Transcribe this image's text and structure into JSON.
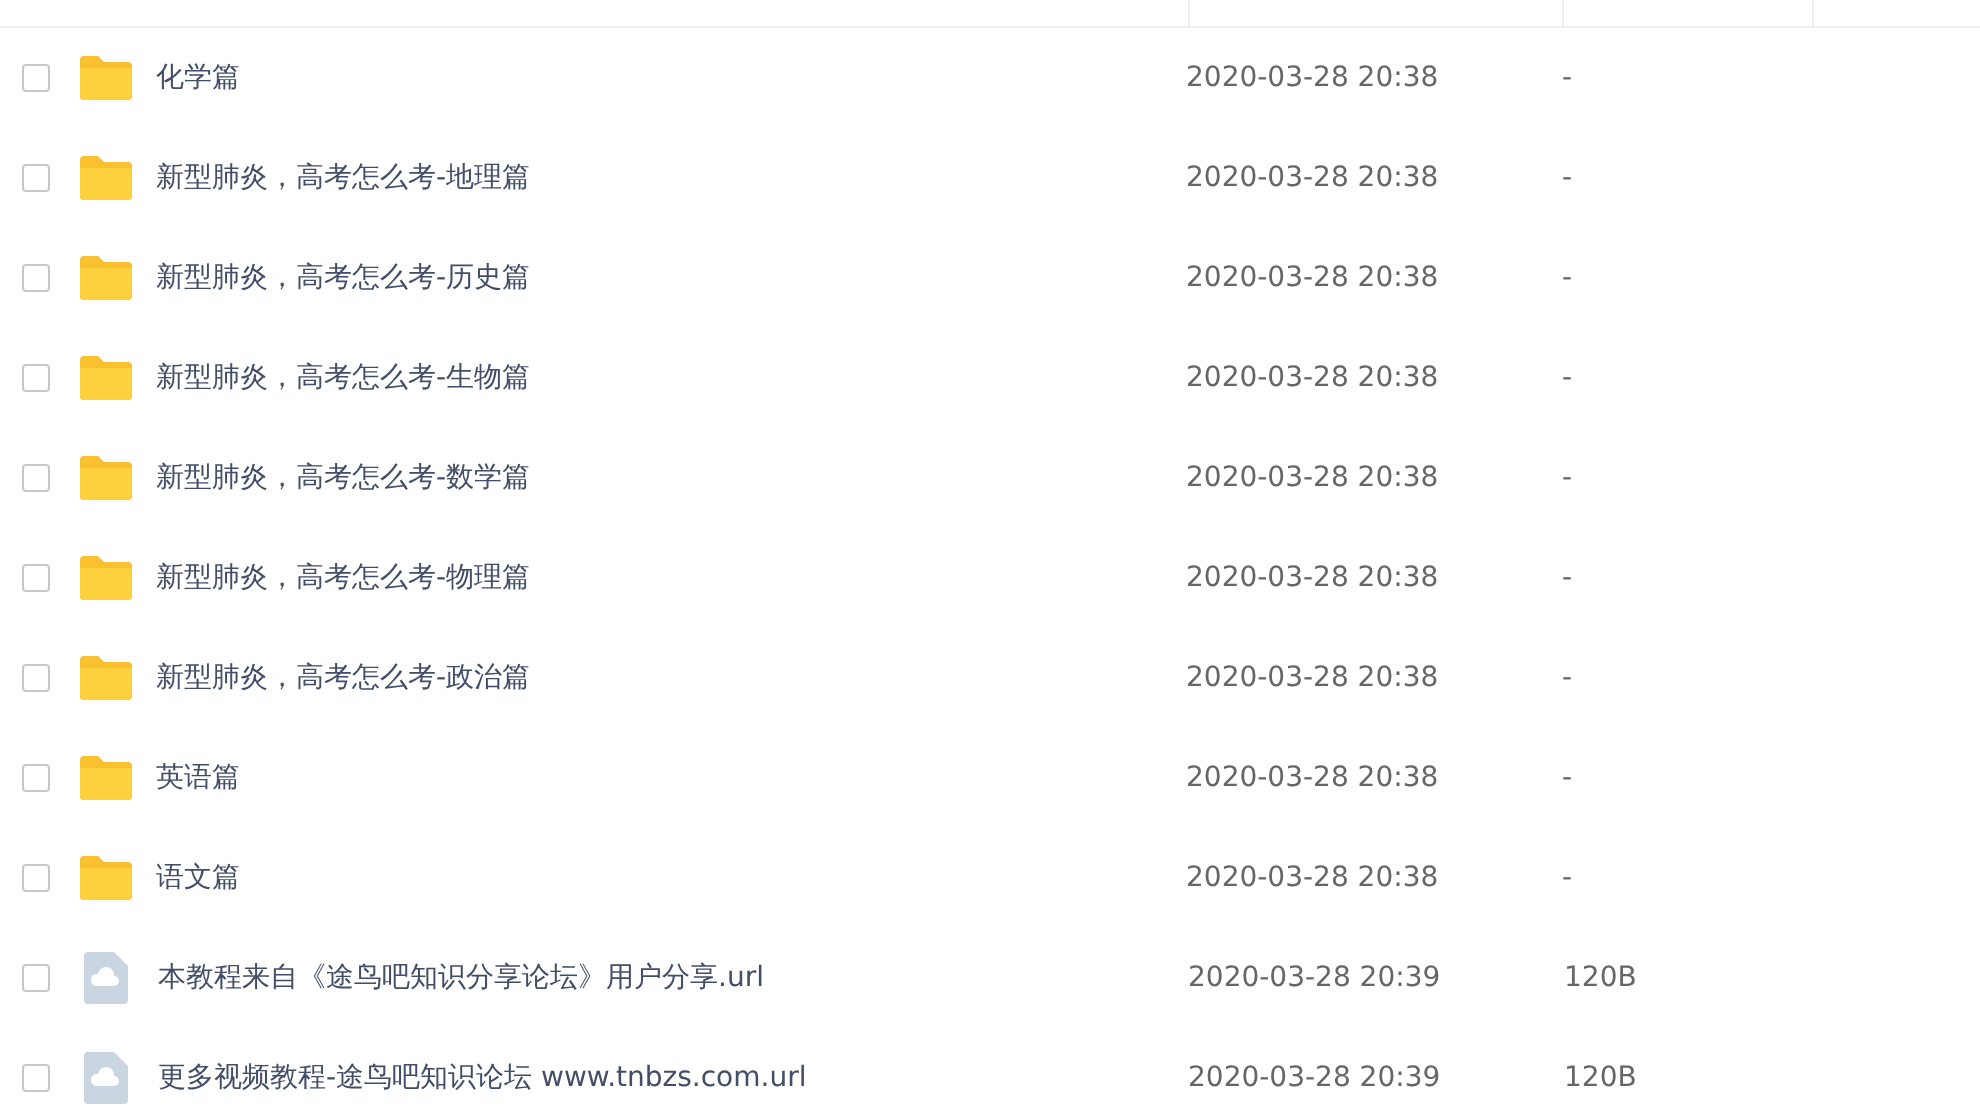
{
  "files": [
    {
      "kind": "folder",
      "name": "化学篇",
      "modified": "2020-03-28 20:38",
      "size": "-",
      "checked": false
    },
    {
      "kind": "folder",
      "name": "新型肺炎，高考怎么考-地理篇",
      "modified": "2020-03-28 20:38",
      "size": "-",
      "checked": false
    },
    {
      "kind": "folder",
      "name": "新型肺炎，高考怎么考-历史篇",
      "modified": "2020-03-28 20:38",
      "size": "-",
      "checked": false
    },
    {
      "kind": "folder",
      "name": "新型肺炎，高考怎么考-生物篇",
      "modified": "2020-03-28 20:38",
      "size": "-",
      "checked": false
    },
    {
      "kind": "folder",
      "name": "新型肺炎，高考怎么考-数学篇",
      "modified": "2020-03-28 20:38",
      "size": "-",
      "checked": false
    },
    {
      "kind": "folder",
      "name": "新型肺炎，高考怎么考-物理篇",
      "modified": "2020-03-28 20:38",
      "size": "-",
      "checked": false
    },
    {
      "kind": "folder",
      "name": "新型肺炎，高考怎么考-政治篇",
      "modified": "2020-03-28 20:38",
      "size": "-",
      "checked": false
    },
    {
      "kind": "folder",
      "name": "英语篇",
      "modified": "2020-03-28 20:38",
      "size": "-",
      "checked": false
    },
    {
      "kind": "folder",
      "name": "语文篇",
      "modified": "2020-03-28 20:38",
      "size": "-",
      "checked": false
    },
    {
      "kind": "file",
      "name": "本教程来自《途鸟吧知识分享论坛》用户分享.url",
      "modified": "2020-03-28 20:39",
      "size": "120B",
      "checked": false
    },
    {
      "kind": "file",
      "name": "更多视频教程-途鸟吧知识论坛 www.tnbzs.com.url",
      "modified": "2020-03-28 20:39",
      "size": "120B",
      "checked": false
    }
  ]
}
